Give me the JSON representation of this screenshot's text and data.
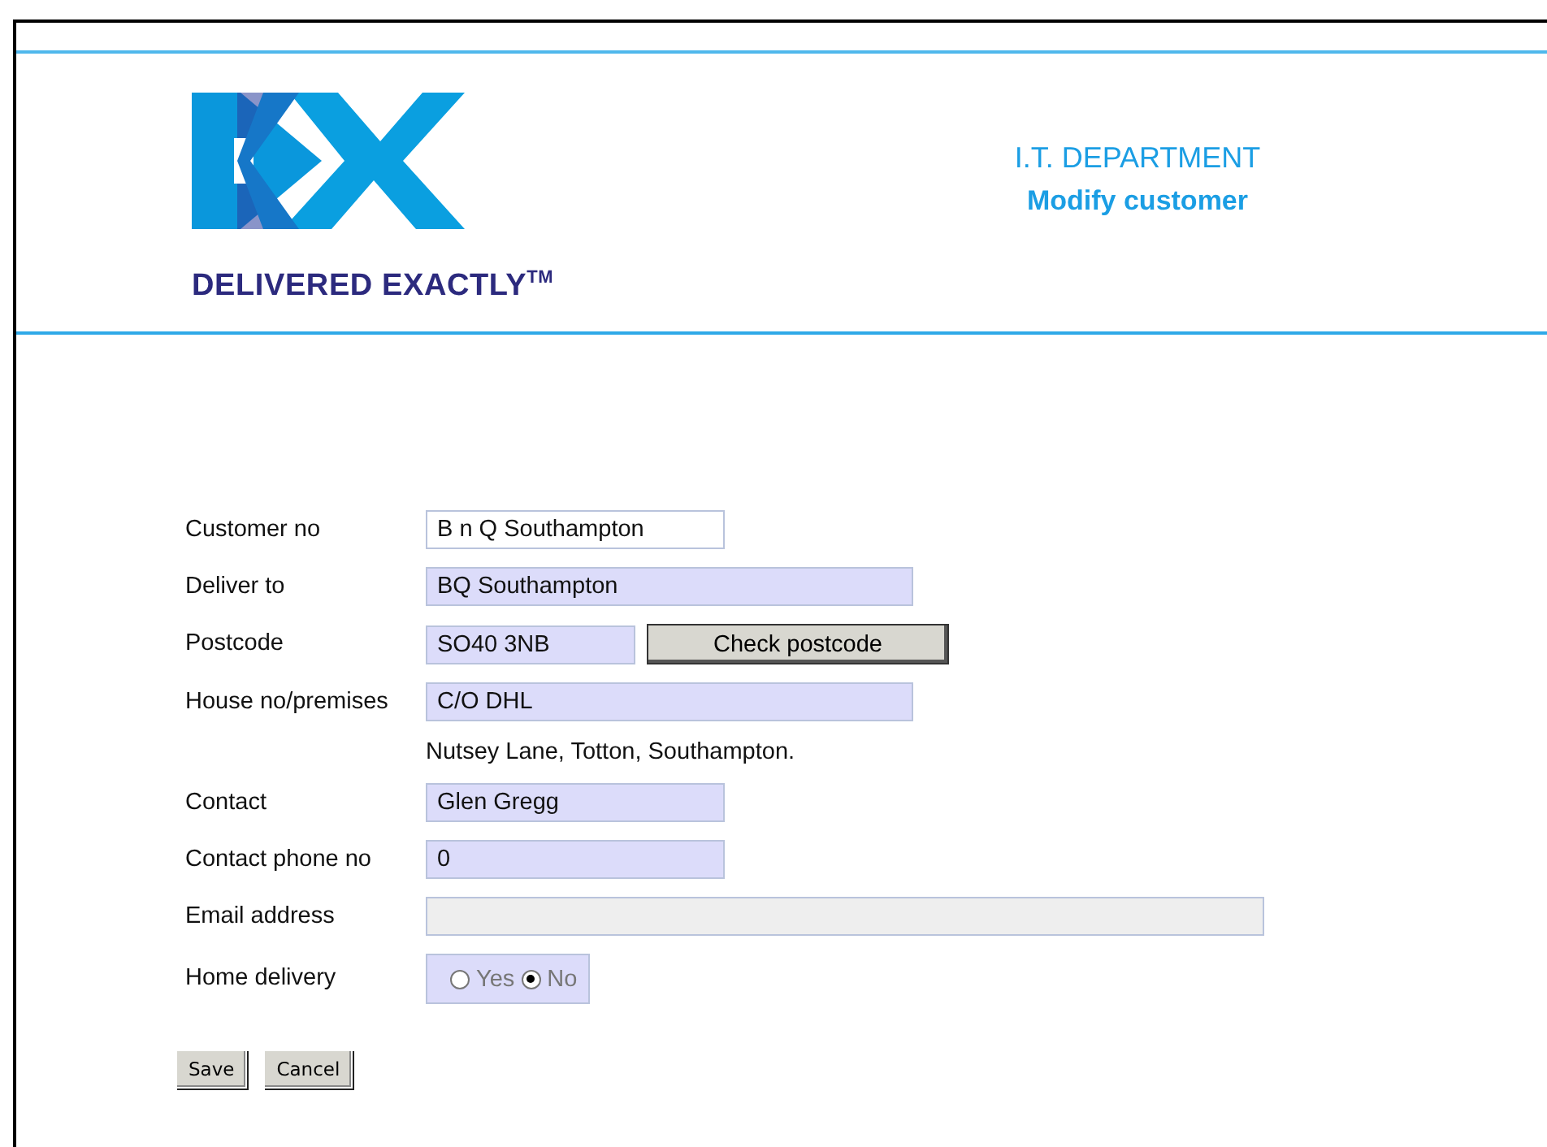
{
  "header": {
    "tagline": "DELIVERED EXACTLY$^{TM}$",
    "department": "I.T. DEPARTMENT",
    "page_title": "Modify customer"
  },
  "fields": [
    {
      "kind": "text",
      "label": "Customer no",
      "value": "B n Q Southampton",
      "highlighted": false,
      "disabled": false
    },
    {
      "kind": "text",
      "label": "Deliver to",
      "value": "BQ Southampton",
      "highlighted": true,
      "disabled": false
    },
    {
      "kind": "text_button",
      "label": "Postcode",
      "value": "SO40 3NB",
      "highlighted": true,
      "disabled": false,
      "button": "Check postcode"
    },
    {
      "kind": "text",
      "label": "House no/premises",
      "value": "C/O DHL",
      "highlighted": true,
      "disabled": false
    },
    {
      "kind": "static",
      "text": "Nutsey Lane, Totton, Southampton."
    },
    {
      "kind": "text",
      "label": "Contact",
      "value": "Glen Gregg",
      "highlighted": true,
      "disabled": false
    },
    {
      "kind": "text",
      "label": "Contact phone no",
      "value": "0",
      "highlighted": true,
      "disabled": false
    },
    {
      "kind": "text",
      "label": "Email address",
      "highlighted": false,
      "disabled": true
    },
    {
      "kind": "radio",
      "label": "Home delivery",
      "highlighted": true,
      "options": [
        {
          "label": "Yes",
          "selected": false
        },
        {
          "label": "No",
          "selected": true
        }
      ]
    }
  ],
  "buttons": [
    "Save",
    "Cancel"
  ]
}
